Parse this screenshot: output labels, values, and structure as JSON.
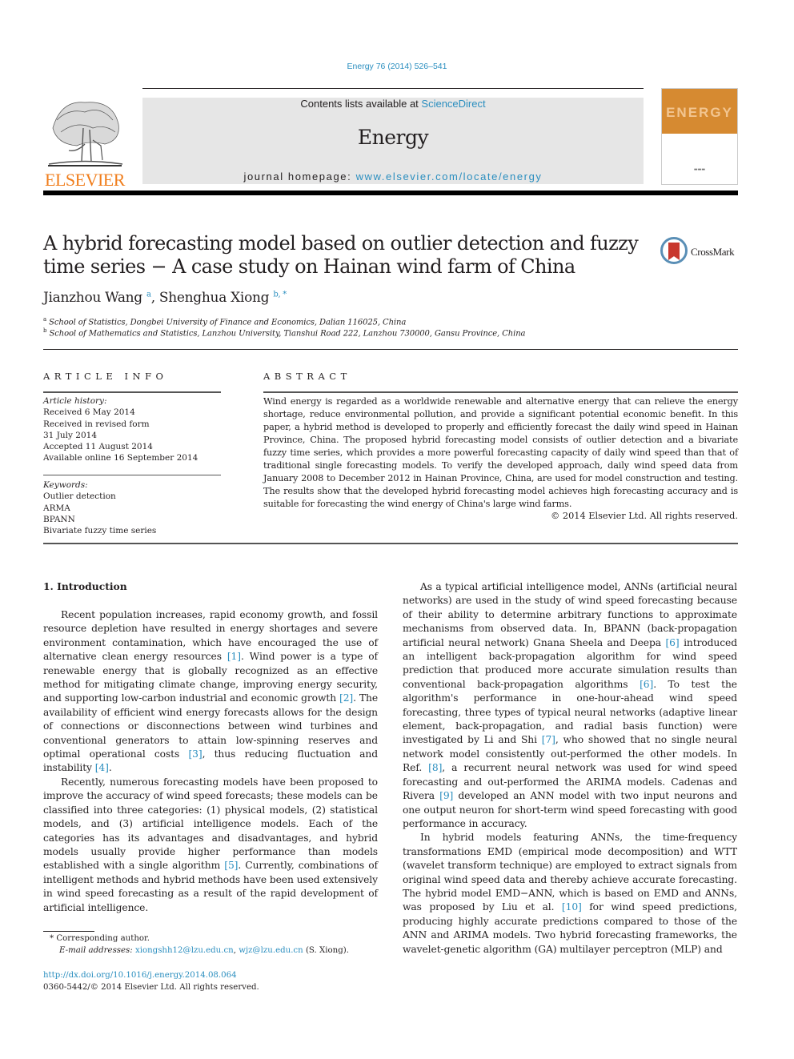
{
  "journal_ref": "Energy 76 (2014) 526–541",
  "masthead": {
    "contents_prefix": "Contents lists available at ",
    "contents_link": "ScienceDirect",
    "journal_title": "Energy",
    "homepage_prefix": "journal homepage: ",
    "homepage_link": "www.elsevier.com/locate/energy"
  },
  "publisher": {
    "wordmark": "ELSEVIER",
    "logo_icon": "elsevier-tree-icon"
  },
  "cover": {
    "word": "ENERGY",
    "icon": "journal-cover-icon"
  },
  "colors": {
    "link": "#2a8ebf",
    "elsevier_orange": "#f07d1b",
    "masthead_bg": "#e6e6e6",
    "cover_orange": "#d68a31"
  },
  "article": {
    "title": "A hybrid forecasting model based on outlier detection and fuzzy time series − A case study on Hainan wind farm of China",
    "crossmark_label": "CrossMark",
    "authors": [
      {
        "name": "Jianzhou Wang",
        "sup": "a"
      },
      {
        "name": "Shenghua Xiong",
        "sup": "b, *"
      }
    ],
    "affiliations": [
      {
        "mark": "a",
        "text": "School of Statistics, Dongbei University of Finance and Economics, Dalian 116025, China"
      },
      {
        "mark": "b",
        "text": "School of Mathematics and Statistics, Lanzhou University, Tianshui Road 222, Lanzhou 730000, Gansu Province, China"
      }
    ]
  },
  "article_info": {
    "heading": "ARTICLE INFO",
    "history_label": "Article history:",
    "history": [
      "Received 6 May 2014",
      "Received in revised form",
      "31 July 2014",
      "Accepted 11 August 2014",
      "Available online 16 September 2014"
    ],
    "keywords_label": "Keywords:",
    "keywords": [
      "Outlier detection",
      "ARMA",
      "BPANN",
      "Bivariate fuzzy time series"
    ]
  },
  "abstract": {
    "heading": "ABSTRACT",
    "text": "Wind energy is regarded as a worldwide renewable and alternative energy that can relieve the energy shortage, reduce environmental pollution, and provide a significant potential economic benefit. In this paper, a hybrid method is developed to properly and efficiently forecast the daily wind speed in Hainan Province, China. The proposed hybrid forecasting model consists of outlier detection and a bivariate fuzzy time series, which provides a more powerful forecasting capacity of daily wind speed than that of traditional single forecasting models. To verify the developed approach, daily wind speed data from January 2008 to December 2012 in Hainan Province, China, are used for model construction and testing. The results show that the developed hybrid forecasting model achieves high forecasting accuracy and is suitable for forecasting the wind energy of China's large wind farms.",
    "copyright": "© 2014 Elsevier Ltd. All rights reserved."
  },
  "body": {
    "section_heading": "1.  Introduction",
    "left_paragraphs": [
      [
        {
          "t": "Recent population increases, rapid economy growth, and fossil resource depletion have resulted in energy shortages and severe environment contamination, which have encouraged the use of alternative clean energy resources "
        },
        {
          "c": "[1]"
        },
        {
          "t": ". Wind power is a type of renewable energy that is globally recognized as an effective method for mitigating climate change, improving energy security, and supporting low-carbon industrial and economic growth "
        },
        {
          "c": "[2]"
        },
        {
          "t": ". The availability of efficient wind energy forecasts allows for the design of connections or disconnections between wind turbines and conventional generators to attain low-spinning reserves and optimal operational costs "
        },
        {
          "c": "[3]"
        },
        {
          "t": ", thus reducing fluctuation and instability "
        },
        {
          "c": "[4]"
        },
        {
          "t": "."
        }
      ],
      [
        {
          "t": "Recently, numerous forecasting models have been proposed to improve the accuracy of wind speed forecasts; these models can be classified into three categories: (1) physical models, (2) statistical models, and (3) artificial intelligence models. Each of the categories has its advantages and disadvantages, and hybrid models usually provide higher performance than models established with a single algorithm "
        },
        {
          "c": "[5]"
        },
        {
          "t": ". Currently, combinations of intelligent methods and hybrid methods have been used extensively in wind speed forecasting as a result of the rapid development of artificial intelligence."
        }
      ]
    ],
    "right_paragraphs": [
      [
        {
          "t": "As a typical artificial intelligence model, ANNs (artificial neural networks) are used in the study of wind speed forecasting because of their ability to determine arbitrary functions to approximate mechanisms from observed data. In, BPANN (back-propagation artificial neural network) Gnana Sheela and Deepa "
        },
        {
          "c": "[6]"
        },
        {
          "t": " introduced an intelligent back-propagation algorithm for wind speed prediction that produced more accurate simulation results than conventional back-propagation algorithms "
        },
        {
          "c": "[6]"
        },
        {
          "t": ". To test the algorithm's performance in one-hour-ahead wind speed forecasting, three types of typical neural networks (adaptive linear element, back-propagation, and radial basis function) were investigated by Li and Shi "
        },
        {
          "c": "[7]"
        },
        {
          "t": ", who showed that no single neural network model consistently out-performed the other models. In Ref. "
        },
        {
          "c": "[8]"
        },
        {
          "t": ", a recurrent neural network was used for wind speed forecasting and out-performed the ARIMA models. Cadenas and Rivera "
        },
        {
          "c": "[9]"
        },
        {
          "t": " developed an ANN model with two input neurons and one output neuron for short-term wind speed forecasting with good performance in accuracy."
        }
      ],
      [
        {
          "t": "In hybrid models featuring ANNs, the time-frequency transformations EMD (empirical mode decomposition) and WTT (wavelet transform technique) are employed to extract signals from original wind speed data and thereby achieve accurate forecasting. The hybrid model EMD−ANN, which is based on EMD and ANNs, was proposed by Liu et al. "
        },
        {
          "c": "[10]"
        },
        {
          "t": " for wind speed predictions, producing highly accurate predictions compared to those of the ANN and ARIMA models. Two hybrid forecasting frameworks, the wavelet-genetic algorithm (GA) multilayer perceptron (MLP) and"
        }
      ]
    ]
  },
  "footnote": {
    "marker": "*",
    "corresponding": "Corresponding author.",
    "email_label": "E-mail addresses:",
    "emails": [
      "xiongshh12@lzu.edu.cn",
      "wjz@lzu.edu.cn"
    ],
    "email_suffix": " (S. Xiong).",
    "doi": "http://dx.doi.org/10.1016/j.energy.2014.08.064",
    "issn_line": "0360-5442/© 2014 Elsevier Ltd. All rights reserved."
  }
}
